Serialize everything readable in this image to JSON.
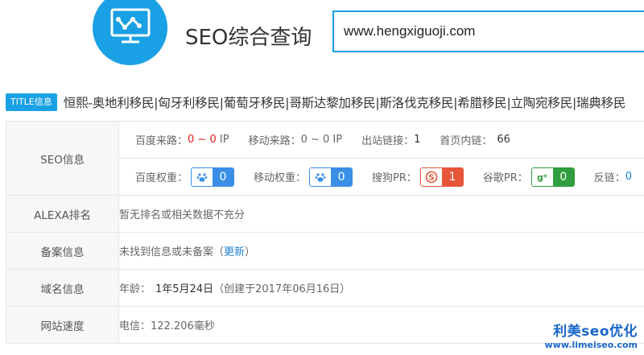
{
  "header": {
    "title": "SEO综合查询",
    "search_value": "www.hengxiguoji.com"
  },
  "title_row": {
    "badge": "TITLE信息",
    "text": "恒熙-奥地利移民|匈牙利移民|葡萄牙移民|哥斯达黎加移民|斯洛伐克移民|希腊移民|立陶宛移民|瑞典移民"
  },
  "seo": {
    "label": "SEO信息",
    "baidu_source": {
      "k": "百度来路：",
      "v1": "0",
      "sep": " ~ ",
      "v2": "0",
      "unit": " IP"
    },
    "mobile_source": {
      "k": "移动来路：",
      "v": "0 ~ 0 IP"
    },
    "outbound": {
      "k": "出站链接：",
      "v": "1"
    },
    "home_links": {
      "k": "首页内链：",
      "v": "66"
    },
    "baidu_weight": {
      "k": "百度权重：",
      "v": "0"
    },
    "mobile_weight": {
      "k": "移动权重：",
      "v": "0"
    },
    "sogou_pr": {
      "k": "搜狗PR：",
      "v": "1"
    },
    "google_pr": {
      "k": "谷歌PR：",
      "v": "0"
    },
    "backlinks": {
      "k": "反链：",
      "v": "0"
    }
  },
  "alexa": {
    "label": "ALEXA排名",
    "value": "暂无排名或相关数据不充分"
  },
  "icp": {
    "label": "备案信息",
    "value": "未找到信息或未备案",
    "open": "（",
    "link": "更新",
    "close": "）"
  },
  "domain": {
    "label": "域名信息",
    "k": "年龄：",
    "age": "1年5月24日",
    "created": "（创建于2017年06月16日）"
  },
  "speed": {
    "label": "网站速度",
    "value": "电信：122.206毫秒"
  },
  "watermark": {
    "line1": "利美seo优化",
    "line2": "www.limeiseo.com"
  },
  "colors": {
    "accent": "#1aa0e4",
    "red": "#e02020",
    "blue_tag": "#3a8ee6",
    "orange_tag": "#e8553a",
    "green_tag": "#2e9e3e"
  },
  "icons": [
    "monitor-chart-icon",
    "baidu-paw-icon",
    "sogou-icon",
    "google-plus-icon"
  ]
}
